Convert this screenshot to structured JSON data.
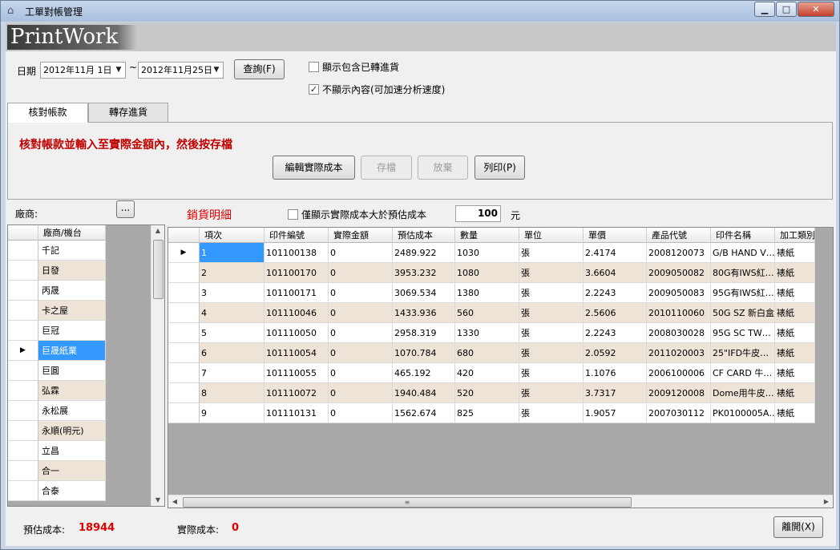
{
  "window": {
    "title": "工單對帳管理",
    "minimize": "▁",
    "maximize": "□",
    "close": "✕"
  },
  "logo": "PrintWork",
  "filter": {
    "date_label": "日期",
    "date_from": "2012年11月 1日",
    "tilde": "~",
    "date_to": "2012年11月25日",
    "query_button": "查詢(F)",
    "include_transferred_label": "顯示包含已轉進貨",
    "include_transferred_checked": false,
    "hide_content_label": "不顯示內容(可加速分析速度)",
    "hide_content_checked": true
  },
  "tabs": [
    {
      "label": "核對帳款",
      "active": true
    },
    {
      "label": "轉存進貨",
      "active": false
    }
  ],
  "panel": {
    "instruction": "核對帳款並輸入至實際金額內，然後按存檔",
    "edit_button": "編輯實際成本",
    "save_button": "存檔",
    "discard_button": "放棄",
    "print_button": "列印(P)"
  },
  "vendor": {
    "label": "廠商:",
    "browse_button": "...",
    "detail_title": "銷貨明細"
  },
  "cost_filter": {
    "label": "僅顯示實際成本大於預估成本",
    "checked": false,
    "value": "100",
    "unit": "元"
  },
  "vendor_grid": {
    "header": "廠商/機台",
    "selected_index": 5,
    "rows": [
      "千記",
      "日發",
      "丙晟",
      "卡之屋",
      "巨冠",
      "巨晟紙業",
      "巨圓",
      "弘霖",
      "永松展",
      "永順(明元)",
      "立昌",
      "合一",
      "合泰"
    ]
  },
  "detail_grid": {
    "headers": [
      "項次",
      "印件編號",
      "實際金額",
      "預估成本",
      "數量",
      "單位",
      "單價",
      "產品代號",
      "印件名稱",
      "加工類別"
    ],
    "rows": [
      [
        "1",
        "101100138",
        "0",
        "2489.922",
        "1030",
        "張",
        "2.4174",
        "2008120073",
        "G/B HAND V…",
        "裱紙"
      ],
      [
        "2",
        "101100170",
        "0",
        "3953.232",
        "1080",
        "張",
        "3.6604",
        "2009050082",
        "80G有IWS紅…",
        "裱紙"
      ],
      [
        "3",
        "101100171",
        "0",
        "3069.534",
        "1380",
        "張",
        "2.2243",
        "2009050083",
        "95G有IWS紅…",
        "裱紙"
      ],
      [
        "4",
        "101110046",
        "0",
        "1433.936",
        "560",
        "張",
        "2.5606",
        "2010110060",
        "50G SZ 新白盒",
        "裱紙"
      ],
      [
        "5",
        "101110050",
        "0",
        "2958.319",
        "1330",
        "張",
        "2.2243",
        "2008030028",
        "95G SC TW…",
        "裱紙"
      ],
      [
        "6",
        "101110054",
        "0",
        "1070.784",
        "680",
        "張",
        "2.0592",
        "2011020003",
        "25\"IFD牛皮…",
        "裱紙"
      ],
      [
        "7",
        "101110055",
        "0",
        "465.192",
        "420",
        "張",
        "1.1076",
        "2006100006",
        "CF CARD 牛…",
        "裱紙"
      ],
      [
        "8",
        "101110072",
        "0",
        "1940.484",
        "520",
        "張",
        "3.7317",
        "2009120008",
        "Dome用牛皮…",
        "裱紙"
      ],
      [
        "9",
        "101110131",
        "0",
        "1562.674",
        "825",
        "張",
        "1.9057",
        "2007030112",
        "PK0100005A…",
        "裱紙"
      ]
    ]
  },
  "footer": {
    "estimated_label": "預估成本:",
    "estimated_value": "18944",
    "actual_label": "實際成本:",
    "actual_value": "0",
    "close_button": "離開(X)"
  },
  "colors": {
    "alt_row": "#ede3d6",
    "selection": "#3399ff",
    "red_text": "#e00000",
    "instruction_red": "#c00000"
  }
}
